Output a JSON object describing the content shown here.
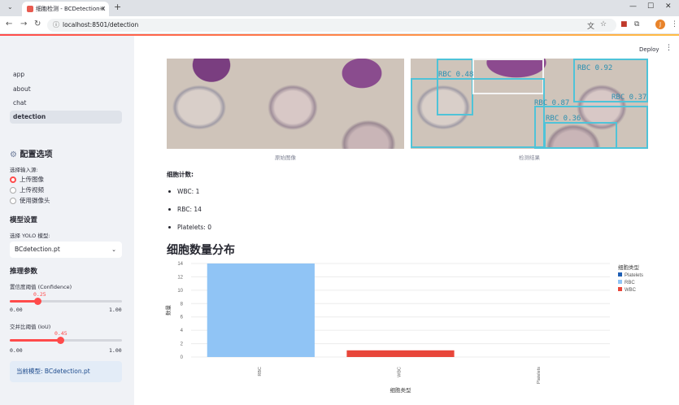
{
  "browser": {
    "tab_title": "细胞检测 - BCDetection-X",
    "tab_close": "×",
    "new_tab": "+",
    "url": "localhost:8501/detection",
    "avatar_initial": "J",
    "window_controls": [
      "—",
      "☐",
      "✕"
    ]
  },
  "header": {
    "deploy": "Deploy",
    "menu": "⋮"
  },
  "sidebar": {
    "nav": [
      {
        "label": "app",
        "active": false
      },
      {
        "label": "about",
        "active": false
      },
      {
        "label": "chat",
        "active": false
      },
      {
        "label": "detection",
        "active": true
      }
    ],
    "config_title": "配置选项",
    "config_icon": "⚙",
    "source_label": "选择输入源:",
    "sources": [
      {
        "label": "上传图像",
        "selected": true
      },
      {
        "label": "上传视频",
        "selected": false
      },
      {
        "label": "使用摄像头",
        "selected": false
      }
    ],
    "model_title": "模型设置",
    "model_label": "选择 YOLO 模型:",
    "model_value": "BCdetection.pt",
    "infer_title": "推理参数",
    "confidence": {
      "label": "置信度阈值 (Confidence)",
      "value": "0.25",
      "fraction": 0.25,
      "min": "0.00",
      "max": "1.00"
    },
    "iou": {
      "label": "交并比阈值 (IoU)",
      "value": "0.45",
      "fraction": 0.45,
      "min": "0.00",
      "max": "1.00"
    },
    "current_model": "当前模型: BCdetection.pt"
  },
  "main": {
    "original_caption": "原始图像",
    "detected_caption": "检测结果",
    "detections": [
      "RBC 0.48",
      "RBC 0.92",
      "RBC 0.87",
      "RBC 0.37",
      "RBC 0.36"
    ],
    "count_title": "细胞计数:",
    "counts": [
      "WBC: 1",
      "RBC: 14",
      "Platelets: 0"
    ],
    "chart_title": "细胞数量分布"
  },
  "colors": {
    "accent": "#ff4b4b",
    "rbc": "#90c4f5",
    "wbc": "#e8463a",
    "platelets": "#1f5fb4"
  },
  "chart_data": {
    "type": "bar",
    "categories": [
      "RBC",
      "WBC",
      "Platelets"
    ],
    "values": [
      14,
      1,
      0
    ],
    "bar_colors": [
      "#90c4f5",
      "#e8463a",
      "#1f5fb4"
    ],
    "title": "",
    "xlabel": "细胞类型",
    "ylabel": "数量",
    "ylim": [
      0,
      14
    ],
    "yticks": [
      0,
      2,
      4,
      6,
      8,
      10,
      12,
      14
    ],
    "legend_title": "细胞类型",
    "legend": [
      {
        "name": "Platelets",
        "color": "#1f5fb4"
      },
      {
        "name": "RBC",
        "color": "#90c4f5"
      },
      {
        "name": "WBC",
        "color": "#e8463a"
      }
    ],
    "legend_position": "right",
    "grid": true
  }
}
